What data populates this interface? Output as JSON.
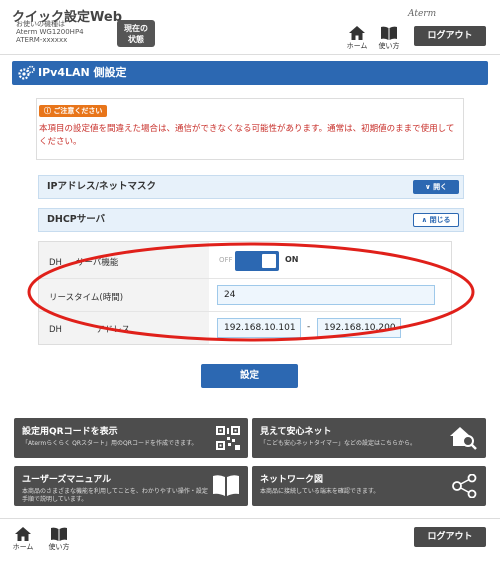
{
  "header": {
    "app_title": "クイック設定Web",
    "device_caption": "お使いの機種は",
    "device_model": "Aterm WG1200HP4",
    "device_name": "ATERM-xxxxxx",
    "status_button": [
      "現在の",
      "状態"
    ],
    "home_label": "ホーム",
    "help_label": "使い方",
    "brand": "Aterm",
    "logout_label": "ログアウト"
  },
  "section": {
    "title": "IPv4LAN 側設定"
  },
  "caution": {
    "badge": "ご注意ください",
    "text": "本項目の設定値を間違えた場合は、通信ができなくなる可能性があります。通常は、初期値のままで使用してください。"
  },
  "accordions": [
    {
      "label": "IPアドレス/ネットマスク",
      "button": "開く"
    },
    {
      "label": "DHCPサーバ",
      "button": "閉じる"
    }
  ],
  "dhcp": {
    "function_label": "DHCPサーバ機能",
    "function_label_visible": "DH",
    "function_label_visible_2": "サーバ機能",
    "toggle_off": "OFF",
    "toggle_on": "ON",
    "lease_label": "リースタイム(時間)",
    "lease_value": "24",
    "range_label_visible": "DH",
    "range_label_visible_2": "アドレス",
    "range_start": "192.168.10.101",
    "range_separator": "-",
    "range_end": "192.168.10.200"
  },
  "submit_label": "設定",
  "cards": [
    {
      "title": "設定用QRコードを表示",
      "desc": "「Atermらくらく QRスタート」用のQRコードを作成できます。",
      "icon": "qr-code-icon"
    },
    {
      "title": "見えて安心ネット",
      "desc": "「こども安心ネットタイマー」などの設定はこちらから。",
      "icon": "home-search-icon"
    },
    {
      "title": "ユーザーズマニュアル",
      "desc": "本商品のさまざまな機能を利用してことを、わかりやすい操作・設定手順で説明しています。",
      "icon": "book-icon"
    },
    {
      "title": "ネットワーク図",
      "desc": "本商品に接続している端末を確認できます。",
      "icon": "share-icon"
    }
  ],
  "footer": {
    "home_label": "ホーム",
    "help_label": "使い方",
    "logout_label": "ログアウト"
  },
  "colors": {
    "primary": "#2c68b2",
    "caution": "#c8302b",
    "annotation": "#e0201a",
    "dark": "#4d4d4d"
  }
}
